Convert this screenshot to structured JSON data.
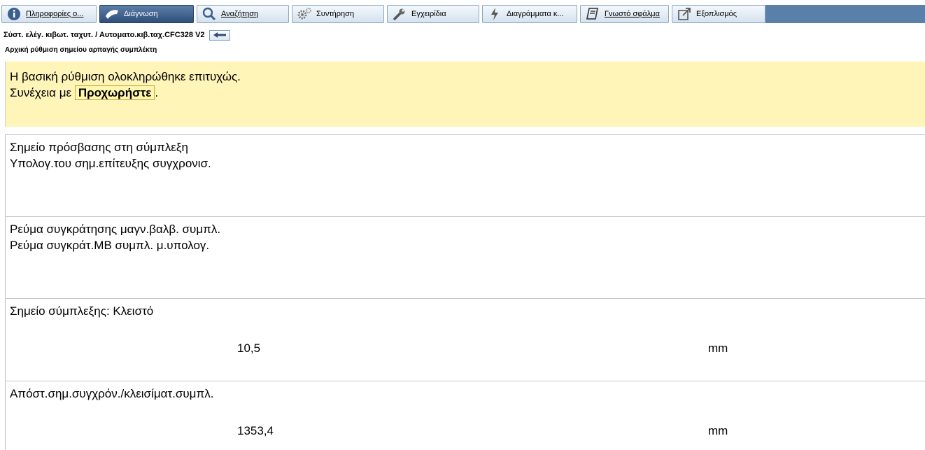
{
  "tabs": [
    {
      "label": "Πληροφορίες ο...",
      "icon": "info-icon",
      "active": false
    },
    {
      "label": "Διάγνωση",
      "icon": "stethoscope-icon",
      "active": true
    },
    {
      "label": "Αναζήτηση",
      "icon": "search-icon",
      "active": false
    },
    {
      "label": "Συντήρηση",
      "icon": "gears-icon",
      "active": false
    },
    {
      "label": "Εγχειρίδια",
      "icon": "wrench-icon",
      "active": false
    },
    {
      "label": "Διαγράμματα κ...",
      "icon": "lightning-icon",
      "active": false
    },
    {
      "label": "Γνωστό σφάλμα",
      "icon": "book-icon",
      "active": false
    },
    {
      "label": "Εξοπλισμός",
      "icon": "external-link-icon",
      "active": false
    }
  ],
  "breadcrumb": "Σύστ. ελέγ. κιβωτ. ταχυτ. / Αυτοματο.κιβ.ταχ.CFC328 V2",
  "subtitle": "Αρχική ρύθμιση σημείου αρπαγής συμπλέκτη",
  "message": {
    "line1": "Η βασική ρύθμιση ολοκληρώθηκε επιτυχώς.",
    "line2_prefix": "Συνέχεια με",
    "proceed_label": "Προχωρήστε",
    "line2_suffix": "."
  },
  "blocks": [
    {
      "line1": "Σημείο πρόσβασης στη σύμπλεξη",
      "line2": "Υπολογ.του σημ.επίτευξης συγχρονισ."
    },
    {
      "line1": "Ρεύμα συγκράτησης μαγν.βαλβ. συμπλ.",
      "line2": "Ρεύμα συγκράτ.ΜΒ συμπλ. μ.υπολογ."
    },
    {
      "line1": "Σημείο σύμπλεξης: Κλειστό",
      "value": "10,5",
      "unit": "mm"
    },
    {
      "line1": "Απόστ.σημ.συγχρόν./κλεισίματ.συμπλ.",
      "value": "1353,4",
      "unit": "mm"
    }
  ],
  "colors": {
    "active_tab": "#3d5f8c",
    "message_bg": "#fff5b9"
  }
}
